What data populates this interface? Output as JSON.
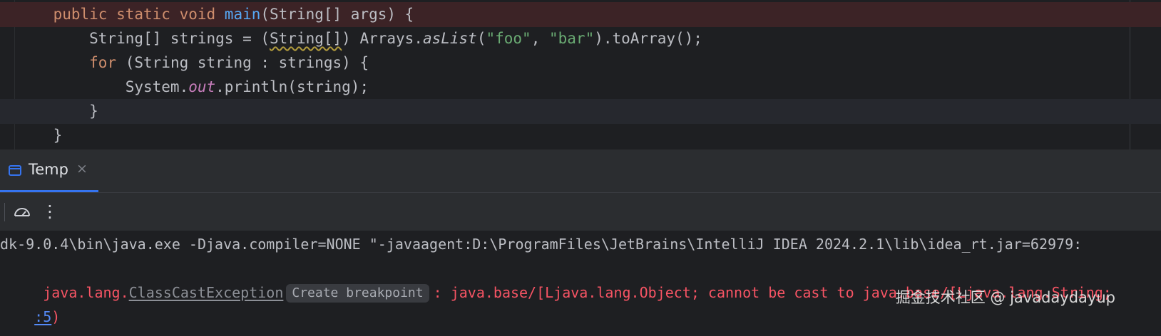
{
  "editor": {
    "lines": [
      {
        "parts": [
          {
            "t": "    "
          },
          {
            "t": "public static void ",
            "c": "kw"
          },
          {
            "t": "main",
            "c": "fn"
          },
          {
            "t": "(String[] args) {"
          }
        ],
        "highlight": "breakpoint"
      },
      {
        "parts": [
          {
            "t": "        String[] strings = ("
          },
          {
            "t": "String[]",
            "c": "warn"
          },
          {
            "t": ") Arrays."
          },
          {
            "t": "asList",
            "c": "it"
          },
          {
            "t": "("
          },
          {
            "t": "\"foo\"",
            "c": "str"
          },
          {
            "t": ", "
          },
          {
            "t": "\"bar\"",
            "c": "str"
          },
          {
            "t": ").toArray();"
          }
        ],
        "highlight": ""
      },
      {
        "parts": [
          {
            "t": "        "
          },
          {
            "t": "for",
            "c": "kw"
          },
          {
            "t": " (String string : strings) {"
          }
        ],
        "highlight": ""
      },
      {
        "parts": [
          {
            "t": "            System."
          },
          {
            "t": "out",
            "c": "fld"
          },
          {
            "t": ".println(string);"
          }
        ],
        "highlight": ""
      },
      {
        "parts": [
          {
            "t": "        }"
          }
        ],
        "highlight": "caret"
      },
      {
        "parts": [
          {
            "t": "    }"
          }
        ],
        "highlight": ""
      }
    ]
  },
  "tool_window": {
    "tab_title": "Temp",
    "tab_close": "×",
    "toolbar_more": "⋮"
  },
  "console": {
    "command_line": "dk-9.0.4\\bin\\java.exe -Djava.compiler=NONE \"-javaagent:D:\\ProgramFiles\\JetBrains\\IntelliJ IDEA 2024.2.1\\lib\\idea_rt.jar=62979:",
    "error_prefix": " java.lang.",
    "exception_class": "ClassCastException",
    "breakpoint_chip": "Create breakpoint",
    "error_message": ": java.base/[Ljava.lang.Object; cannot be cast to java.base/[Ljava.lang.String;",
    "trace_link": ":5",
    "trace_suffix": ")"
  },
  "watermark": "掘金技术社区 @ javadaydayup",
  "colors": {
    "editor_bg": "#1e1f22",
    "breakpoint_line_bg": "#3c2326",
    "keyword": "#cf8e6d",
    "function": "#56a8f5",
    "string": "#6aab73",
    "static_field": "#c77dbb",
    "error_text": "#f75464",
    "link": "#548af7",
    "accent": "#3574f0"
  }
}
